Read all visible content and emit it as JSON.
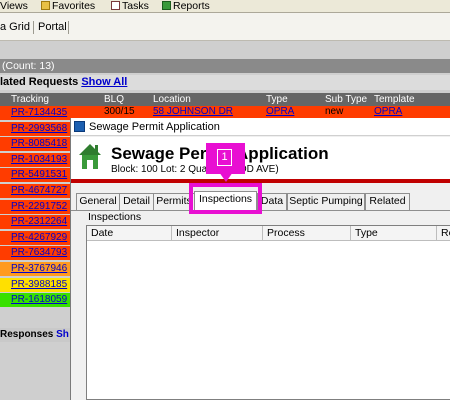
{
  "menu": {
    "items": [
      {
        "label": "Views",
        "icon": "none"
      },
      {
        "label": "Favorites",
        "icon": "folder-star-icon"
      },
      {
        "label": "Tasks",
        "icon": "tasks-icon"
      },
      {
        "label": "Reports",
        "icon": "reports-icon"
      }
    ]
  },
  "toolbar": {
    "tabs": [
      {
        "label": "a Grid"
      },
      {
        "label": "Portal"
      }
    ]
  },
  "count_bar": {
    "text": "(Count: 13)"
  },
  "related": {
    "title": "lated Requests",
    "show_all": "Show All"
  },
  "columns": [
    "Tracking",
    "BLQ",
    "Location",
    "Type",
    "Sub Type",
    "Template"
  ],
  "first_row": {
    "blq": "300/15",
    "location": "58 JOHNSON DR",
    "type": "OPRA",
    "sub_type": "new",
    "template": "OPRA"
  },
  "rows": [
    {
      "tracking": "PR-7134435",
      "color": "#ff3c00"
    },
    {
      "tracking": "PR-2993568",
      "color": "#ff3c00"
    },
    {
      "tracking": "PR-8085418",
      "color": "#ff3c00"
    },
    {
      "tracking": "PR-1034193",
      "color": "#ff3c00"
    },
    {
      "tracking": "PR-5491531",
      "color": "#ff3c00"
    },
    {
      "tracking": "PR-4674727",
      "color": "#ff3c00"
    },
    {
      "tracking": "PR-2291752",
      "color": "#ff3c00"
    },
    {
      "tracking": "PR-2312264",
      "color": "#ff3c00"
    },
    {
      "tracking": "PR-4267929",
      "color": "#ff3c00"
    },
    {
      "tracking": "PR-7634793",
      "color": "#ff3c00"
    },
    {
      "tracking": "PR-3767946",
      "color": "#ff9a1f"
    },
    {
      "tracking": "PR-3988185",
      "color": "#ffe000"
    },
    {
      "tracking": "PR-1618059",
      "color": "#38e000"
    }
  ],
  "responses": {
    "label": "Responses",
    "link": "Sh"
  },
  "modal": {
    "window_title": "Sewage Permit Application",
    "header_title": "Sewage Permit Application",
    "header_sub": "Block: 100 Lot: 2 Qual:     KWOOD AVE)",
    "tabs": [
      {
        "label": "General"
      },
      {
        "label": "Detail"
      },
      {
        "label": "Permits"
      },
      {
        "label": "Inspections"
      },
      {
        "label": "Data"
      },
      {
        "label": "Septic Pumping"
      },
      {
        "label": "Related"
      }
    ],
    "section_label": "Inspections",
    "grid_columns": [
      "Date",
      "Inspector",
      "Process",
      "Type",
      "Re"
    ]
  },
  "annotation": {
    "badge_text": "1",
    "color": "#e80fd2"
  }
}
